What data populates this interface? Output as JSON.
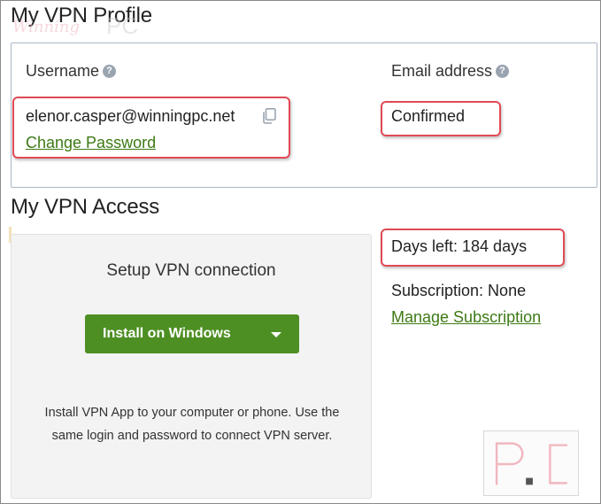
{
  "profile": {
    "heading": "My VPN Profile",
    "watermark": "WinningPC",
    "username_label": "Username",
    "username_value": "elenor.casper@winningpc.net",
    "change_password_link": "Change Password",
    "email_label": "Email address",
    "email_status": "Confirmed"
  },
  "access": {
    "heading": "My VPN Access",
    "setup_title": "Setup VPN connection",
    "install_button": "Install on Windows",
    "description": "Install VPN App to your computer or phone. Use the same login and password to connect VPN server.",
    "days_left": "Days left: 184 days",
    "subscription": "Subscription: None",
    "manage_subscription_link": "Manage Subscription"
  },
  "corner_watermark": "P.C",
  "colors": {
    "link_green": "#3d7a14",
    "button_green": "#4e8f24",
    "highlight_red": "#e04a55",
    "help_icon": "#9aa4b0"
  },
  "icons": {
    "help": "question-circle-icon",
    "copy": "copy-icon",
    "dropdown": "caret-down-icon"
  }
}
